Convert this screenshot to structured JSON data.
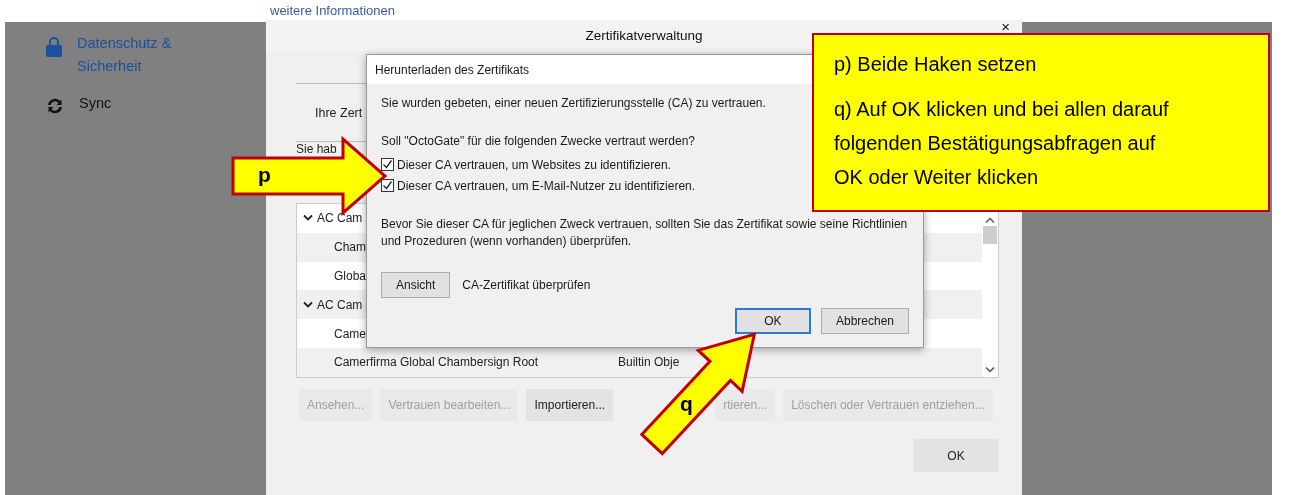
{
  "top_link": "weitere Informationen",
  "sidebar": {
    "items": [
      {
        "kind": "lock",
        "label": "Datenschutz & Sicherheit",
        "selected": true
      },
      {
        "kind": "sync",
        "label": "Sync",
        "selected": false
      }
    ]
  },
  "window": {
    "title": "Zertifikatverwaltung",
    "close": "×",
    "tab_label": "Ihre Zert",
    "intro": "Sie hab",
    "tree": {
      "rows": [
        {
          "kind": "group",
          "expanded": true,
          "name": "AC Cam"
        },
        {
          "kind": "item",
          "name": "Cham"
        },
        {
          "kind": "item",
          "name": "Globa"
        },
        {
          "kind": "group",
          "expanded": true,
          "name": "AC Cam"
        },
        {
          "kind": "item",
          "name": "Came"
        },
        {
          "kind": "item",
          "name": "Camerfirma Global Chambersign Root",
          "column_2": "Builtin Obje"
        }
      ]
    },
    "buttons": [
      {
        "label": "Ansehen...",
        "disabled": true
      },
      {
        "label": "Vertrauen bearbeiten...",
        "disabled": true
      },
      {
        "label": "Importieren...",
        "disabled": false
      },
      {
        "label": "rtieren...",
        "disabled": true
      },
      {
        "label": "Löschen oder Vertrauen entziehen...",
        "disabled": true
      }
    ],
    "ok": "OK"
  },
  "dialog": {
    "title": "Herunterladen des Zertifikats",
    "message": "Sie wurden gebeten, einer neuen Zertifizierungsstelle (CA) zu vertrauen.",
    "question": "Soll \"OctoGate\" für die folgenden Zwecke vertraut werden?",
    "options": [
      {
        "label": "Dieser CA vertrauen, um Websites zu identifizieren.",
        "checked": true
      },
      {
        "label": "Dieser CA vertrauen, um E-Mail-Nutzer zu identifizieren.",
        "checked": true
      }
    ],
    "advice": "Bevor Sie dieser CA für jeglichen Zweck vertrauen, sollten Sie das Zertifikat sowie seine Richtlinien und Prozeduren (wenn vorhanden) überprüfen.",
    "view_button": "Ansicht",
    "view_caption": "CA-Zertifikat überprüfen",
    "buttons": [
      {
        "label": "OK",
        "default": true
      },
      {
        "label": "Abbrechen",
        "default": false
      }
    ]
  },
  "annotations": {
    "arrows": [
      {
        "label": "p"
      },
      {
        "label": "q"
      }
    ],
    "note": {
      "paragraphs": [
        "p) Beide Haken setzen",
        "q) Auf OK klicken und bei allen darauf folgenden Bestätigungsabfragen auf OK oder Weiter klicken"
      ]
    }
  }
}
